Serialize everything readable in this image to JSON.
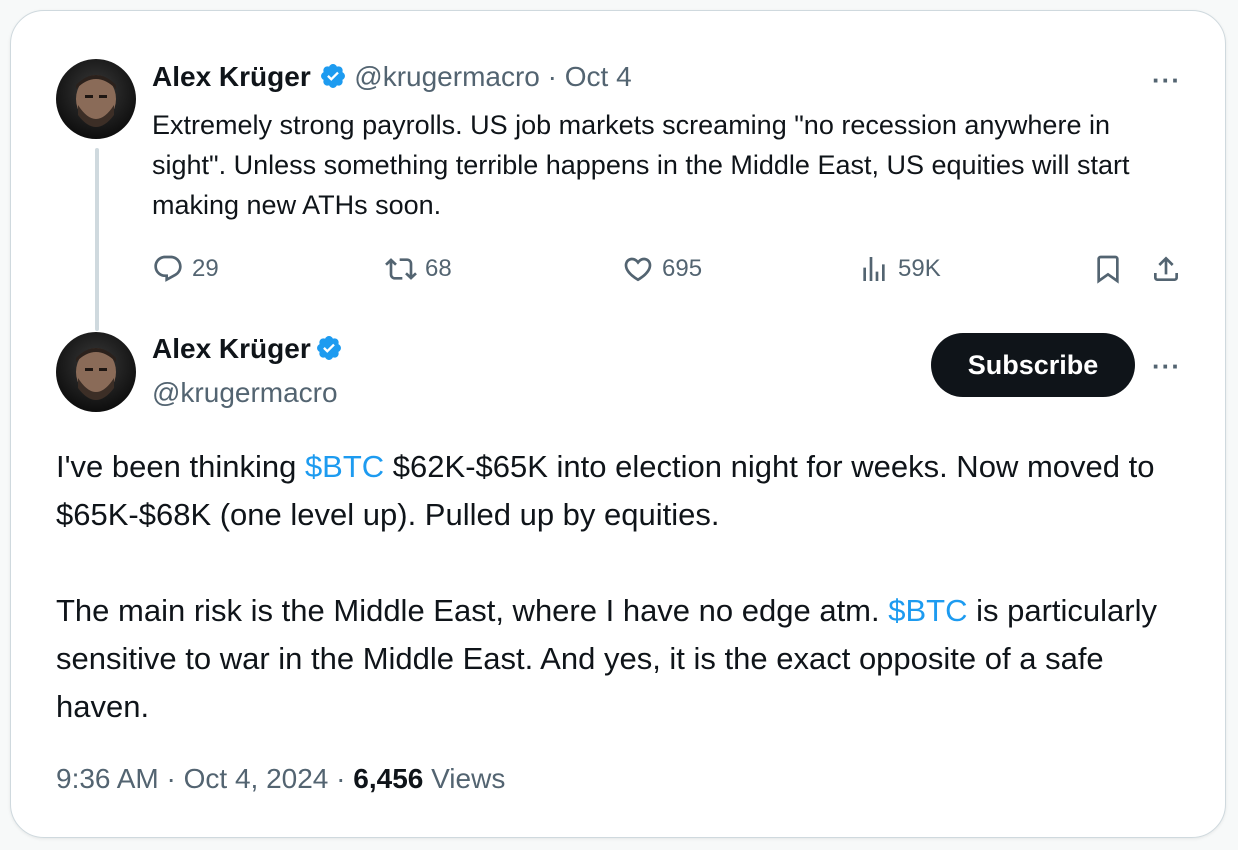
{
  "quoted": {
    "author_name": "Alex Krüger",
    "handle": "@krugermacro",
    "separator": "·",
    "date": "Oct 4",
    "text": "Extremely strong payrolls. US job markets screaming \"no recession anywhere in sight\". Unless something terrible happens in the Middle East, US equities will start making new ATHs soon.",
    "replies": "29",
    "reposts": "68",
    "likes": "695",
    "views": "59K"
  },
  "main": {
    "author_name": "Alex Krüger",
    "handle": "@krugermacro",
    "subscribe_label": "Subscribe",
    "p1_pre": "I've been thinking ",
    "cashtag1": "$BTC",
    "p1_post": " $62K-$65K into election night for weeks. Now moved to $65K-$68K (one level up). Pulled up by equities.",
    "p2_pre": "The main risk is the Middle East, where I have no edge atm. ",
    "cashtag2": "$BTC",
    "p2_post": " is particularly sensitive to war in the Middle East. And yes, it is the exact opposite of a safe haven.",
    "time": "9:36 AM",
    "date": "Oct 4, 2024",
    "separator": "·",
    "views_count": "6,456",
    "views_label": "Views"
  },
  "more_label": "···",
  "colors": {
    "accent": "#1d9bf0",
    "text": "#0f1419",
    "muted": "#536471",
    "border": "#cfd9de"
  },
  "icons": [
    "verified-badge-icon",
    "reply-icon",
    "repost-icon",
    "like-icon",
    "views-icon",
    "bookmark-icon",
    "share-icon",
    "more-icon"
  ]
}
